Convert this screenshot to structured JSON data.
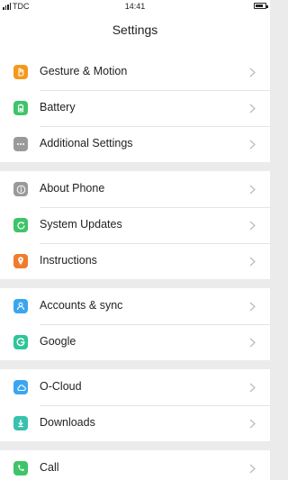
{
  "status_bar": {
    "carrier": "TDC",
    "time": "14:41",
    "battery_level": 0.8
  },
  "header": {
    "title": "Settings"
  },
  "groups": [
    {
      "items": [
        {
          "label": "Gesture & Motion",
          "icon": "gesture-icon",
          "color": "#f39a1e"
        },
        {
          "label": "Battery",
          "icon": "battery-icon",
          "color": "#3fc46a"
        },
        {
          "label": "Additional Settings",
          "icon": "more-dots-icon",
          "color": "#9a9a9a"
        }
      ]
    },
    {
      "items": [
        {
          "label": "About Phone",
          "icon": "info-icon",
          "color": "#9a9a9a"
        },
        {
          "label": "System Updates",
          "icon": "update-icon",
          "color": "#3fc46a"
        },
        {
          "label": "Instructions",
          "icon": "instructions-icon",
          "color": "#f07c2e"
        }
      ]
    },
    {
      "items": [
        {
          "label": "Accounts & sync",
          "icon": "account-icon",
          "color": "#3aa6f0"
        },
        {
          "label": "Google",
          "icon": "google-icon",
          "color": "#2ec59a"
        }
      ]
    },
    {
      "items": [
        {
          "label": "O-Cloud",
          "icon": "cloud-icon",
          "color": "#3aa6f0"
        },
        {
          "label": "Downloads",
          "icon": "download-icon",
          "color": "#37c2ae"
        }
      ]
    },
    {
      "items": [
        {
          "label": "Call",
          "icon": "phone-icon",
          "color": "#3fc46a"
        }
      ]
    }
  ]
}
